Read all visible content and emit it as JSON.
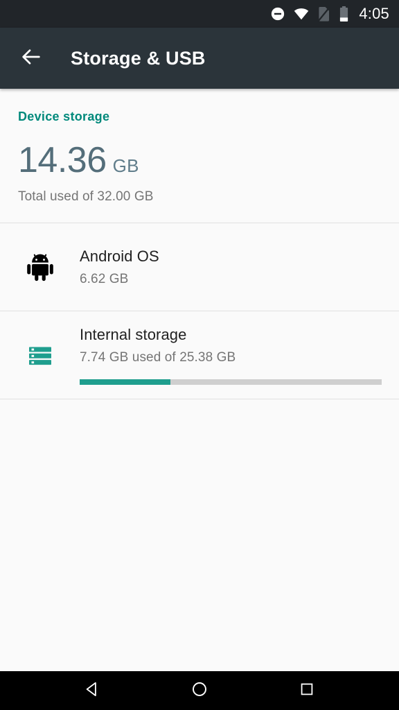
{
  "status_bar": {
    "time": "4:05",
    "icons": [
      {
        "name": "do-not-disturb-icon",
        "color": "#ffffff"
      },
      {
        "name": "wifi-icon",
        "color": "#ffffff"
      },
      {
        "name": "no-sim-icon",
        "color": "#5a6066"
      },
      {
        "name": "battery-icon",
        "color": "#ffffff"
      }
    ],
    "background": "#212529"
  },
  "toolbar": {
    "title": "Storage & USB",
    "back_icon": "arrow-back-icon",
    "background": "#2b343a"
  },
  "summary": {
    "header": "Device storage",
    "total_value": "14.36",
    "total_unit": "GB",
    "caption": "Total used of 32.00 GB",
    "accent_color": "#00897b",
    "value_color": "#546e7a"
  },
  "storage_items": [
    {
      "icon": "android-robot-icon",
      "icon_color": "#000000",
      "title": "Android OS",
      "subtitle": "6.62 GB",
      "has_progress": false
    },
    {
      "icon": "internal-storage-icon",
      "icon_color": "#1f9e8e",
      "title": "Internal storage",
      "subtitle": "7.74 GB used of 25.38 GB",
      "has_progress": true,
      "progress_percent": 30,
      "progress_color": "#1f9e8e",
      "track_color": "#cfcfcf"
    }
  ],
  "nav_bar": {
    "background": "#000000",
    "buttons": [
      {
        "name": "nav-back-button",
        "icon": "triangle-back-icon"
      },
      {
        "name": "nav-home-button",
        "icon": "circle-home-icon"
      },
      {
        "name": "nav-recents-button",
        "icon": "square-recents-icon"
      }
    ]
  }
}
